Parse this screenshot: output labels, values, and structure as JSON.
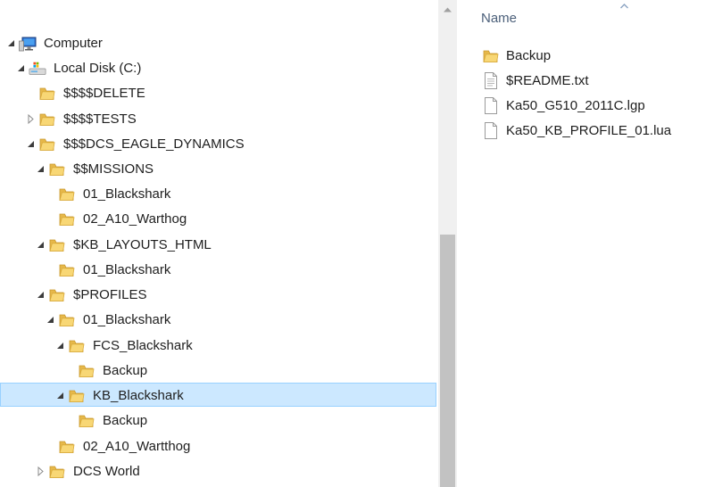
{
  "tree": {
    "items": [
      {
        "label": "Computer",
        "icon": "computer-icon",
        "state": "expanded",
        "selected": false
      },
      {
        "label": "Local Disk (C:)",
        "icon": "drive-icon",
        "state": "expanded",
        "selected": false
      },
      {
        "label": "$$$$DELETE",
        "icon": "folder-icon",
        "state": "none",
        "selected": false
      },
      {
        "label": "$$$$TESTS",
        "icon": "folder-icon",
        "state": "collapsed",
        "selected": false
      },
      {
        "label": "$$$DCS_EAGLE_DYNAMICS",
        "icon": "folder-icon",
        "state": "expanded",
        "selected": false
      },
      {
        "label": "$$MISSIONS",
        "icon": "folder-icon",
        "state": "expanded",
        "selected": false
      },
      {
        "label": "01_Blackshark",
        "icon": "folder-icon",
        "state": "none",
        "selected": false
      },
      {
        "label": "02_A10_Warthog",
        "icon": "folder-icon",
        "state": "none",
        "selected": false
      },
      {
        "label": "$KB_LAYOUTS_HTML",
        "icon": "folder-icon",
        "state": "expanded",
        "selected": false
      },
      {
        "label": "01_Blackshark",
        "icon": "folder-icon",
        "state": "none",
        "selected": false
      },
      {
        "label": "$PROFILES",
        "icon": "folder-icon",
        "state": "expanded",
        "selected": false
      },
      {
        "label": "01_Blackshark",
        "icon": "folder-icon",
        "state": "expanded",
        "selected": false
      },
      {
        "label": "FCS_Blackshark",
        "icon": "folder-icon",
        "state": "expanded",
        "selected": false
      },
      {
        "label": "Backup",
        "icon": "folder-icon",
        "state": "none",
        "selected": false
      },
      {
        "label": "KB_Blackshark",
        "icon": "folder-icon",
        "state": "expanded",
        "selected": true
      },
      {
        "label": "Backup",
        "icon": "folder-icon",
        "state": "none",
        "selected": false
      },
      {
        "label": "02_A10_Wartthog",
        "icon": "folder-icon",
        "state": "none",
        "selected": false
      },
      {
        "label": "DCS World",
        "icon": "folder-icon",
        "state": "collapsed",
        "selected": false
      }
    ]
  },
  "list": {
    "column_name": "Name",
    "sort": "ascending",
    "items": [
      {
        "label": "Backup",
        "icon": "folder-icon"
      },
      {
        "label": "$README.txt",
        "icon": "text-file-icon"
      },
      {
        "label": "Ka50_G510_2011C.lgp",
        "icon": "file-icon"
      },
      {
        "label": "Ka50_KB_PROFILE_01.lua",
        "icon": "file-icon"
      }
    ]
  },
  "colors": {
    "selection_bg": "#cce8ff",
    "selection_border": "#99d1ff",
    "folder_yellow": "#f8d775",
    "header_text": "#4c607a"
  }
}
